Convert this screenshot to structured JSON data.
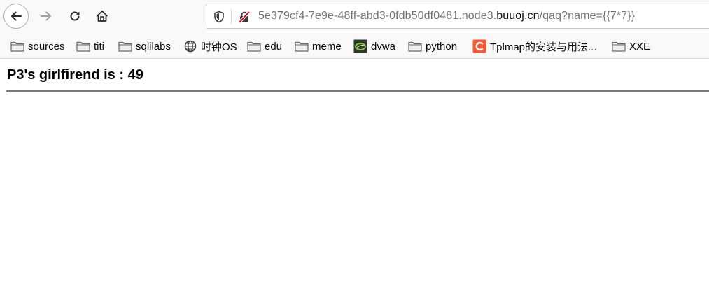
{
  "browser": {
    "url": {
      "prefix": "5e379cf4-7e9e-48ff-abd3-0fdb50df0481.node3.",
      "domain": "buuoj.cn",
      "path": "/qaq?name={{7*7}}"
    },
    "icons": {
      "back": "arrow-left-icon",
      "forward": "arrow-right-icon",
      "reload": "reload-icon",
      "home": "home-icon",
      "tracking": "shield-icon",
      "insecure": "insecure-lock-icon"
    }
  },
  "bookmarks": [
    {
      "label": "sources",
      "icon": "folder-icon"
    },
    {
      "label": "titi",
      "icon": "folder-icon"
    },
    {
      "label": "sqlilabs",
      "icon": "folder-icon"
    },
    {
      "label": "时钟OS",
      "icon": "globe-icon"
    },
    {
      "label": "edu",
      "icon": "folder-icon"
    },
    {
      "label": "meme",
      "icon": "folder-icon"
    },
    {
      "label": "dvwa",
      "icon": "dvwa-favicon-icon"
    },
    {
      "label": "python",
      "icon": "folder-icon"
    },
    {
      "label": "Tplmap的安装与用法...",
      "icon": "csdn-favicon-icon"
    },
    {
      "label": "XXE",
      "icon": "folder-icon"
    }
  ],
  "page": {
    "heading": "P3's girlfirend is : 49"
  },
  "colors": {
    "toolbar_bg": "#f9f9fa",
    "url_muted": "#737373",
    "insecure_red": "#d70022",
    "csdn_orange": "#fc5531",
    "rule": "#7a7a7a"
  }
}
